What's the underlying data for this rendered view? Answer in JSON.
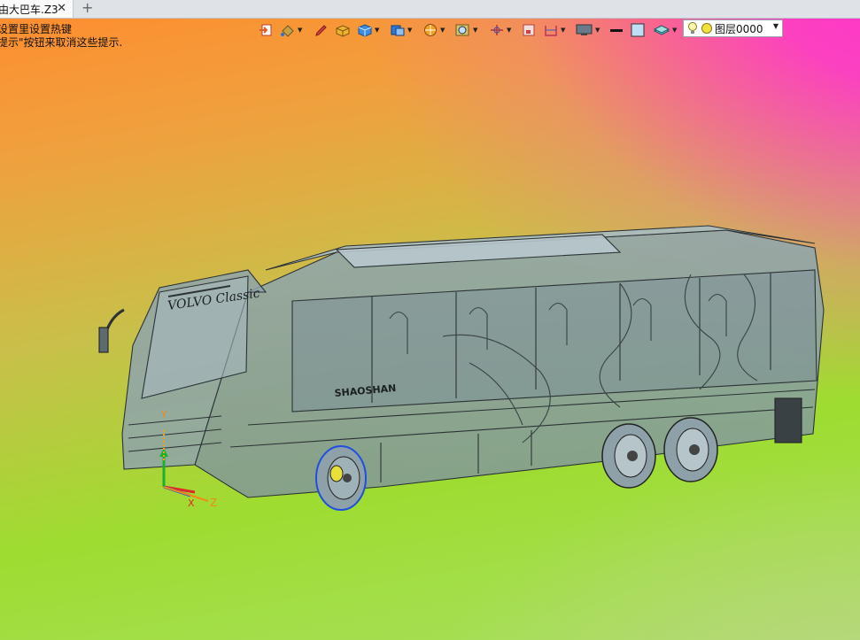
{
  "tab": {
    "title": "由大巴车.Z3",
    "close_symbol": "✕",
    "add_symbol": "+"
  },
  "hints": [
    "设置里设置热键",
    "提示\"按钮来取消这些提示."
  ],
  "toolbar": {
    "icons": [
      "exit-icon",
      "paint-bucket-icon",
      "pen-icon",
      "box-shade-icon",
      "cube-icon",
      "view-cube-icon",
      "sphere-icon",
      "zoom-icon",
      "axis-icon",
      "frame-icon",
      "section-icon",
      "monitor-icon",
      "line-width-icon",
      "color-swatch-icon",
      "layer-stack-icon"
    ]
  },
  "layer": {
    "value": "图层0000",
    "icon": "bulb-icon"
  },
  "model": {
    "logo_text": "VOLVO Classic",
    "side_text": "SHAOSHAN",
    "axes": {
      "x": "X",
      "y": "Y",
      "z": "Z"
    }
  },
  "colors": {
    "accent_blue": "#1f4fe0",
    "axis_green": "#19b22e",
    "axis_red": "#e02828",
    "axis_orange": "#f08a1a"
  }
}
